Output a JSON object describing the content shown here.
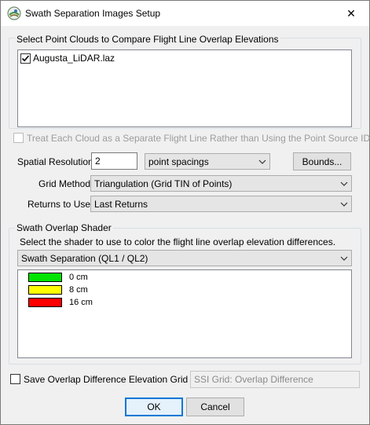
{
  "window": {
    "title": "Swath Separation Images Setup",
    "close_glyph": "✕",
    "icon": "globe-app-icon"
  },
  "point_clouds": {
    "group_label": "Select Point Clouds to Compare Flight Line Overlap Elevations",
    "items": [
      {
        "label": "Augusta_LiDAR.laz",
        "checked": true
      }
    ]
  },
  "separate_flight_line": {
    "label": "Treat Each Cloud as a Separate Flight Line Rather than Using the Point Source ID",
    "checked": false,
    "enabled": false
  },
  "spatial_resolution": {
    "label": "Spatial Resolution:",
    "value": "2",
    "unit_selected": "point spacings",
    "bounds_label": "Bounds..."
  },
  "grid_method": {
    "label": "Grid Method:",
    "selected": "Triangulation (Grid TIN of Points)"
  },
  "returns": {
    "label": "Returns to Use:",
    "selected": "Last Returns"
  },
  "shader": {
    "group_label": "Swath Overlap Shader",
    "instruction": "Select the shader to use to color the flight line overlap elevation differences.",
    "selected": "Swath Separation (QL1 / QL2)",
    "legend": [
      {
        "label": "0 cm",
        "color": "#00e400"
      },
      {
        "label": "8 cm",
        "color": "#ffff00"
      },
      {
        "label": "16 cm",
        "color": "#ff0000"
      }
    ]
  },
  "save_grid": {
    "label": "Save Overlap Difference Elevation Grid as",
    "checked": false,
    "filename": "SSI Grid: Overlap Difference"
  },
  "buttons": {
    "ok": "OK",
    "cancel": "Cancel"
  }
}
